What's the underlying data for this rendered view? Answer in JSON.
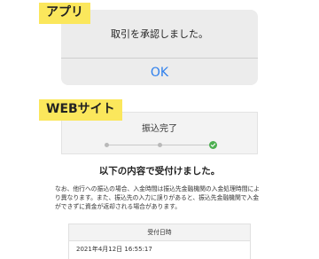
{
  "labels": {
    "app": "アプリ",
    "web": "WEBサイト"
  },
  "app_dialog": {
    "message": "取引を承認しました。",
    "ok_button": "OK"
  },
  "web": {
    "step_title": "振込完了",
    "steps": {
      "total": 3,
      "current": 3
    },
    "heading": "以下の内容で受付けました。",
    "note": "なお、他行への振込の場合、入金時間は振込先金融機関の入金処理時間により異なります。また、振込先の入力に誤りがあると、振込先金融機関で入金ができずに資金が返却される場合があります。",
    "table": {
      "header": "受付日時",
      "value": "2021年4月12日 16:55:17"
    }
  },
  "colors": {
    "label_bg": "#fbe75c",
    "ok_text": "#2f80ed",
    "step_done": "#4caf50",
    "dialog_bg": "#ececec"
  },
  "icons": {
    "step_complete": "check-circle-icon"
  }
}
